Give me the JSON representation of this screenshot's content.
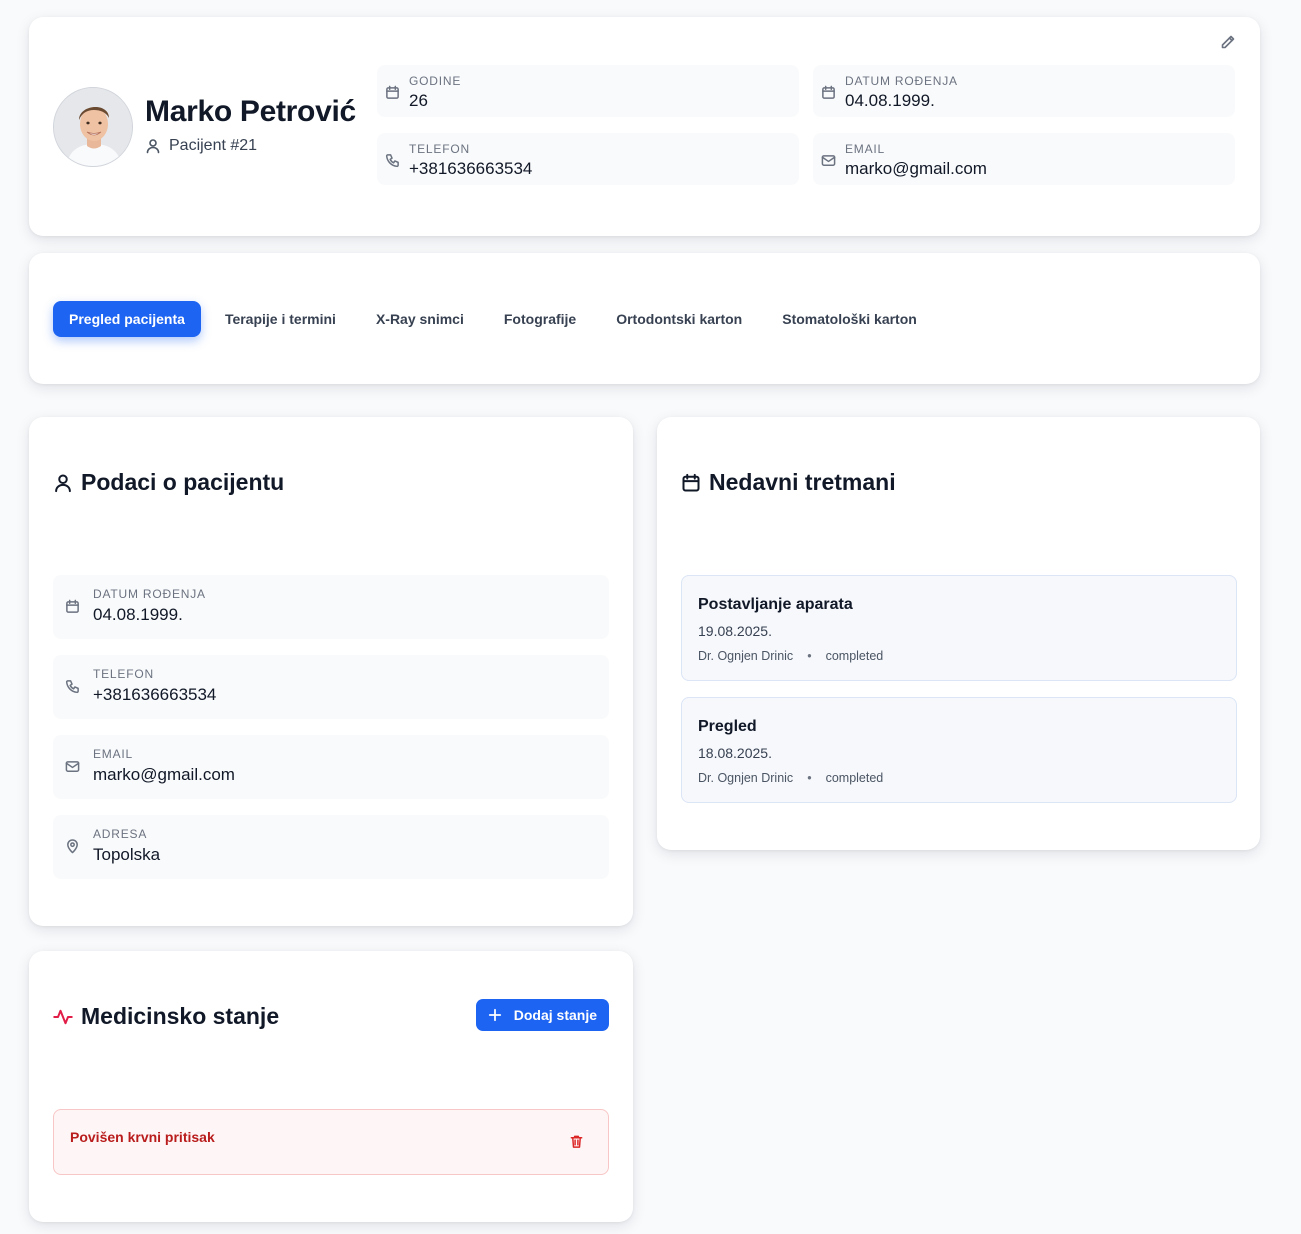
{
  "header": {
    "name": "Marko Petrović",
    "patient_id": "Pacijent #21",
    "info": [
      {
        "label": "GODINE",
        "value": "26",
        "icon": "calendar-icon"
      },
      {
        "label": "DATUM ROĐENJA",
        "value": "04.08.1999.",
        "icon": "calendar-icon"
      },
      {
        "label": "TELEFON",
        "value": "+381636663534",
        "icon": "phone-icon"
      },
      {
        "label": "EMAIL",
        "value": "marko@gmail.com",
        "icon": "mail-icon"
      }
    ]
  },
  "tabs": [
    {
      "label": "Pregled pacijenta",
      "active": true
    },
    {
      "label": "Terapije i termini"
    },
    {
      "label": "X-Ray snimci"
    },
    {
      "label": "Fotografije"
    },
    {
      "label": "Ortodontski karton"
    },
    {
      "label": "Stomatološki karton"
    }
  ],
  "patient_data": {
    "title": "Podaci o pacijentu",
    "rows": [
      {
        "label": "DATUM ROĐENJA",
        "value": "04.08.1999.",
        "icon": "calendar-icon"
      },
      {
        "label": "TELEFON",
        "value": "+381636663534",
        "icon": "phone-icon"
      },
      {
        "label": "EMAIL",
        "value": "marko@gmail.com",
        "icon": "mail-icon"
      },
      {
        "label": "ADRESA",
        "value": "Topolska",
        "icon": "map-pin-icon"
      }
    ]
  },
  "treatments": {
    "title": "Nedavni tretmani",
    "items": [
      {
        "name": "Postavljanje aparata",
        "date": "19.08.2025.",
        "doctor": "Dr. Ognjen Drinic",
        "status": "completed"
      },
      {
        "name": "Pregled",
        "date": "18.08.2025.",
        "doctor": "Dr. Ognjen Drinic",
        "status": "completed"
      }
    ]
  },
  "medical": {
    "title": "Medicinsko stanje",
    "add_label": "Dodaj stanje",
    "conditions": [
      {
        "name": "Povišen krvni pritisak"
      }
    ]
  },
  "colors": {
    "accent": "#1d64f2",
    "danger": "#dc2626",
    "background": "#f8fafc"
  }
}
